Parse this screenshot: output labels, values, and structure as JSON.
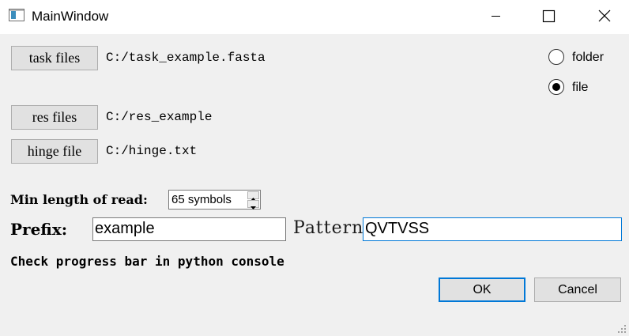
{
  "window": {
    "title": "MainWindow",
    "controls": [
      "minimize-icon",
      "maximize-icon",
      "close-icon"
    ]
  },
  "files": {
    "task": {
      "button_label": "task files",
      "path": "C:/task_example.fasta"
    },
    "res": {
      "button_label": "res files",
      "path": "C:/res_example"
    },
    "hinge": {
      "button_label": "hinge file",
      "path": "C:/hinge.txt"
    }
  },
  "mode": {
    "options": [
      {
        "label": "folder",
        "checked": false
      },
      {
        "label": "file",
        "checked": true
      }
    ]
  },
  "settings": {
    "min_length_label": "Min length of read:",
    "min_length_value": "65 symbols",
    "prefix_label": "Prefix:",
    "prefix_value": "example",
    "pattern_label": "Pattern",
    "pattern_value": "QVTVSS"
  },
  "hint": "Check progress bar in python console",
  "buttons": {
    "ok": "OK",
    "cancel": "Cancel"
  },
  "colors": {
    "focus_accent": "#0078d7",
    "button_face": "#e1e1e1",
    "window_bg": "#f0f0f0"
  }
}
